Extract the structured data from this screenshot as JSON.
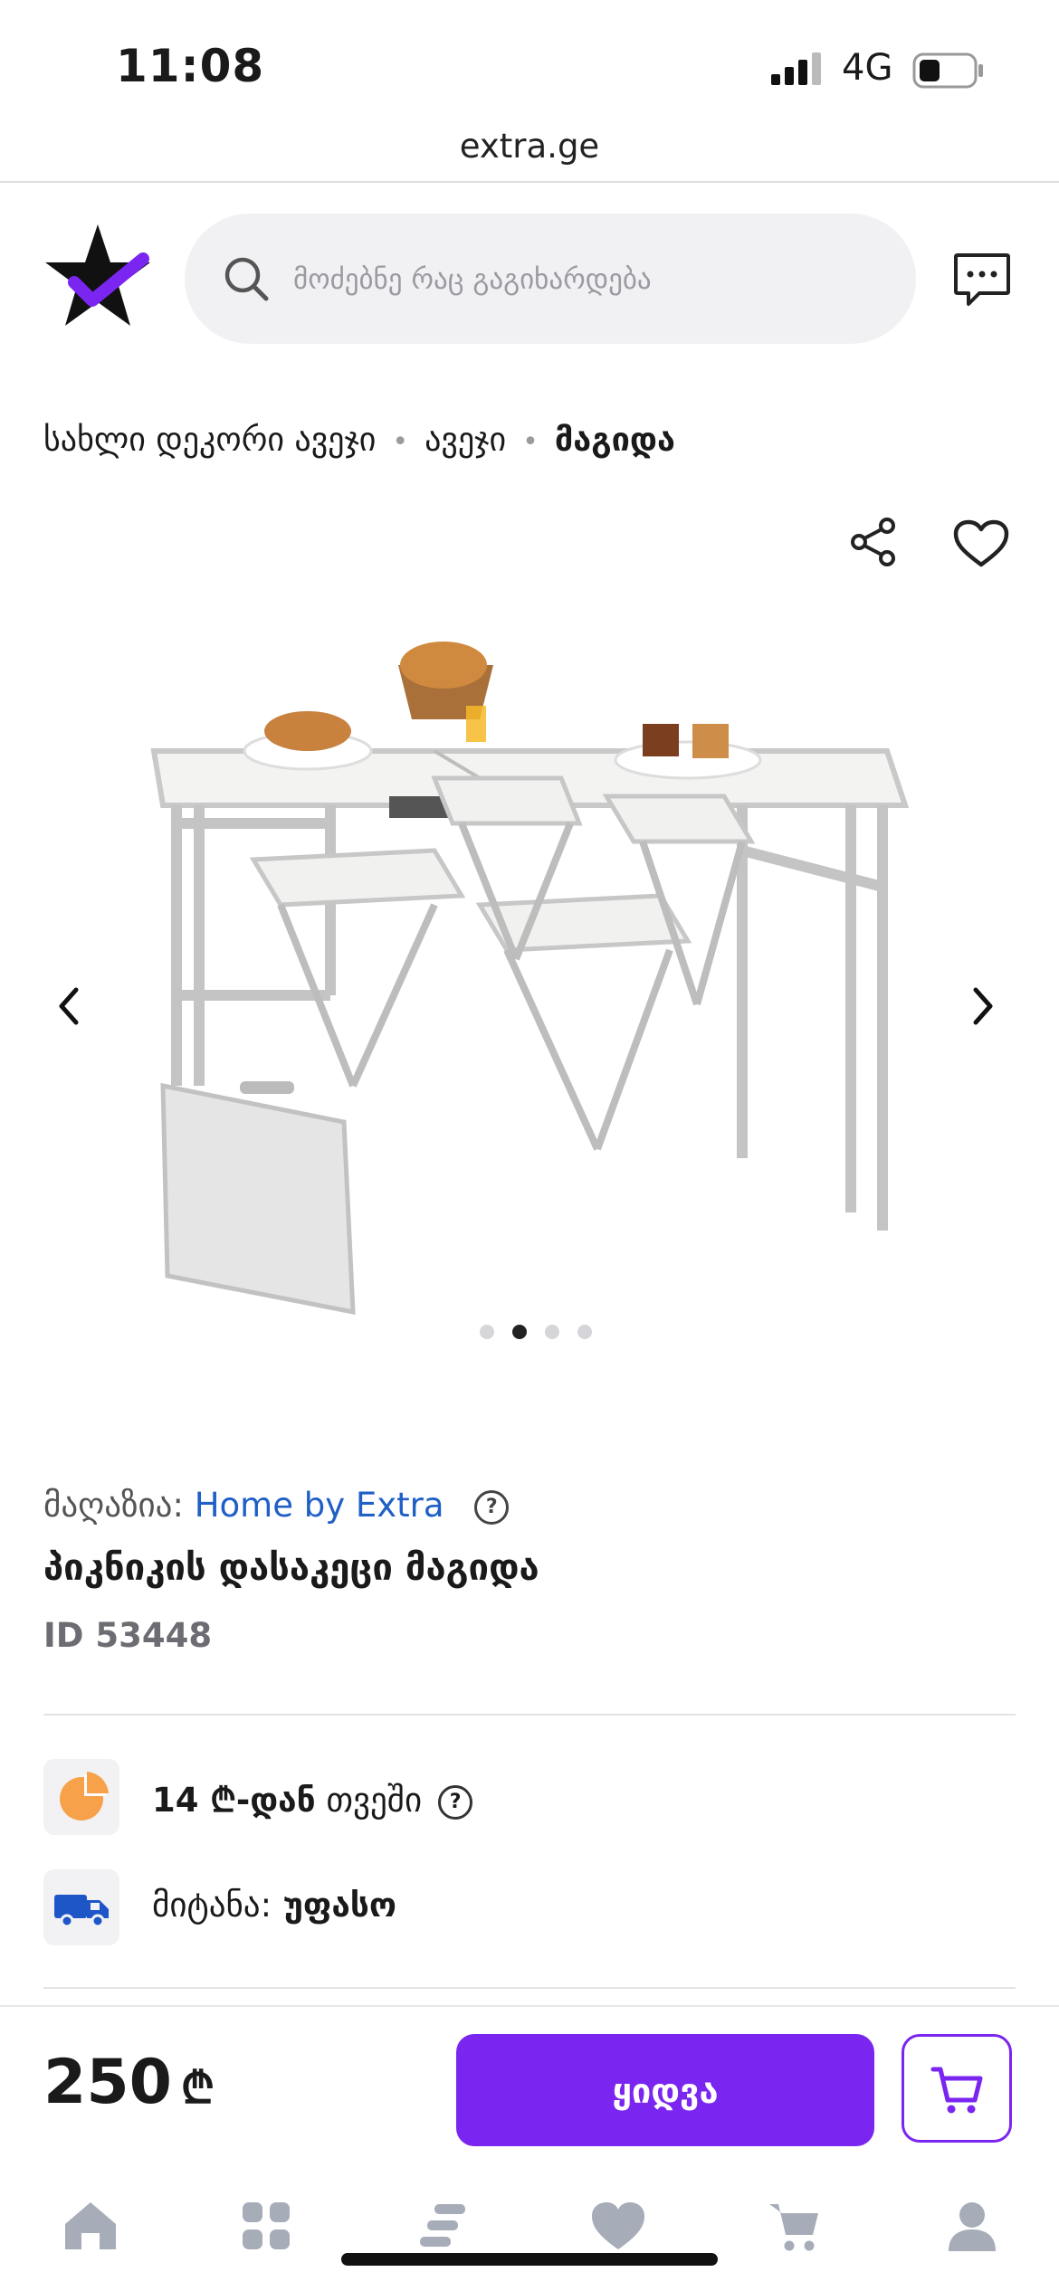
{
  "status_bar": {
    "time": "11:08",
    "network": "4G"
  },
  "browser": {
    "url": "extra.ge"
  },
  "header": {
    "search_placeholder": "მოძებნე რაც გაგიხარდება",
    "icons": [
      "search-icon",
      "chat-icon"
    ]
  },
  "breadcrumb": {
    "items": [
      "სახლი დეკორი ავეჯი",
      "ავეჯი",
      "მაგიდა"
    ]
  },
  "gallery": {
    "total_images": 4,
    "active_index": 1
  },
  "product": {
    "store_label": "მაღაზია:",
    "store_name": "Home by Extra",
    "title": "პიკნიკის დასაკეცი მაგიდა",
    "id_text": "ID 53448"
  },
  "features": {
    "installment_bold": "14 ₾-დან",
    "installment_rest": " თვეში",
    "delivery_label": "მიტანა:",
    "delivery_value": " უფასო"
  },
  "purchase": {
    "price": "250",
    "currency": "₾",
    "buy_label": "ყიდვა"
  },
  "colors": {
    "accent": "#7b25f0",
    "link": "#1f5fc6",
    "installment_icon": "#f7a24a",
    "delivery_icon": "#1e56c8",
    "tab_icons": "#a6acb8"
  },
  "tab_bar": {
    "icons": [
      "home-icon",
      "categories-icon",
      "catalog-icon",
      "favorites-icon",
      "cart-icon",
      "profile-icon"
    ]
  }
}
